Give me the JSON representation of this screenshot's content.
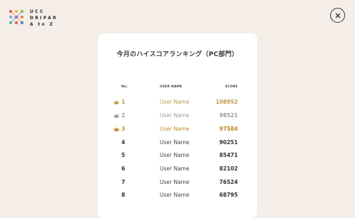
{
  "logo": {
    "lines": [
      "UCC",
      "DRIPAR",
      "A to Z"
    ]
  },
  "title": "今月のハイスコアランキング（PC部門）",
  "table": {
    "headers": {
      "no": "No.",
      "name": "USER NAME",
      "score": "SCORE"
    },
    "rows": [
      {
        "rank": "1",
        "name": "User Name",
        "score": "108952",
        "medal": "gold"
      },
      {
        "rank": "2",
        "name": "User Name",
        "score": "98521",
        "medal": "silver"
      },
      {
        "rank": "3",
        "name": "User Name",
        "score": "97584",
        "medal": "bronze"
      },
      {
        "rank": "4",
        "name": "User Name",
        "score": "90251",
        "medal": "none"
      },
      {
        "rank": "5",
        "name": "User Name",
        "score": "85471",
        "medal": "none"
      },
      {
        "rank": "6",
        "name": "User Name",
        "score": "82102",
        "medal": "none"
      },
      {
        "rank": "7",
        "name": "User Name",
        "score": "76524",
        "medal": "none"
      },
      {
        "rank": "8",
        "name": "User Name",
        "score": "68795",
        "medal": "none"
      }
    ]
  },
  "colors": {
    "background": "#f5eee8",
    "card": "#ffffff",
    "gold": "#c39a4c",
    "silver": "#9c9c9c",
    "bronze": "#c08a28"
  },
  "icons": {
    "close": "close-icon",
    "crown": "crown-icon"
  }
}
